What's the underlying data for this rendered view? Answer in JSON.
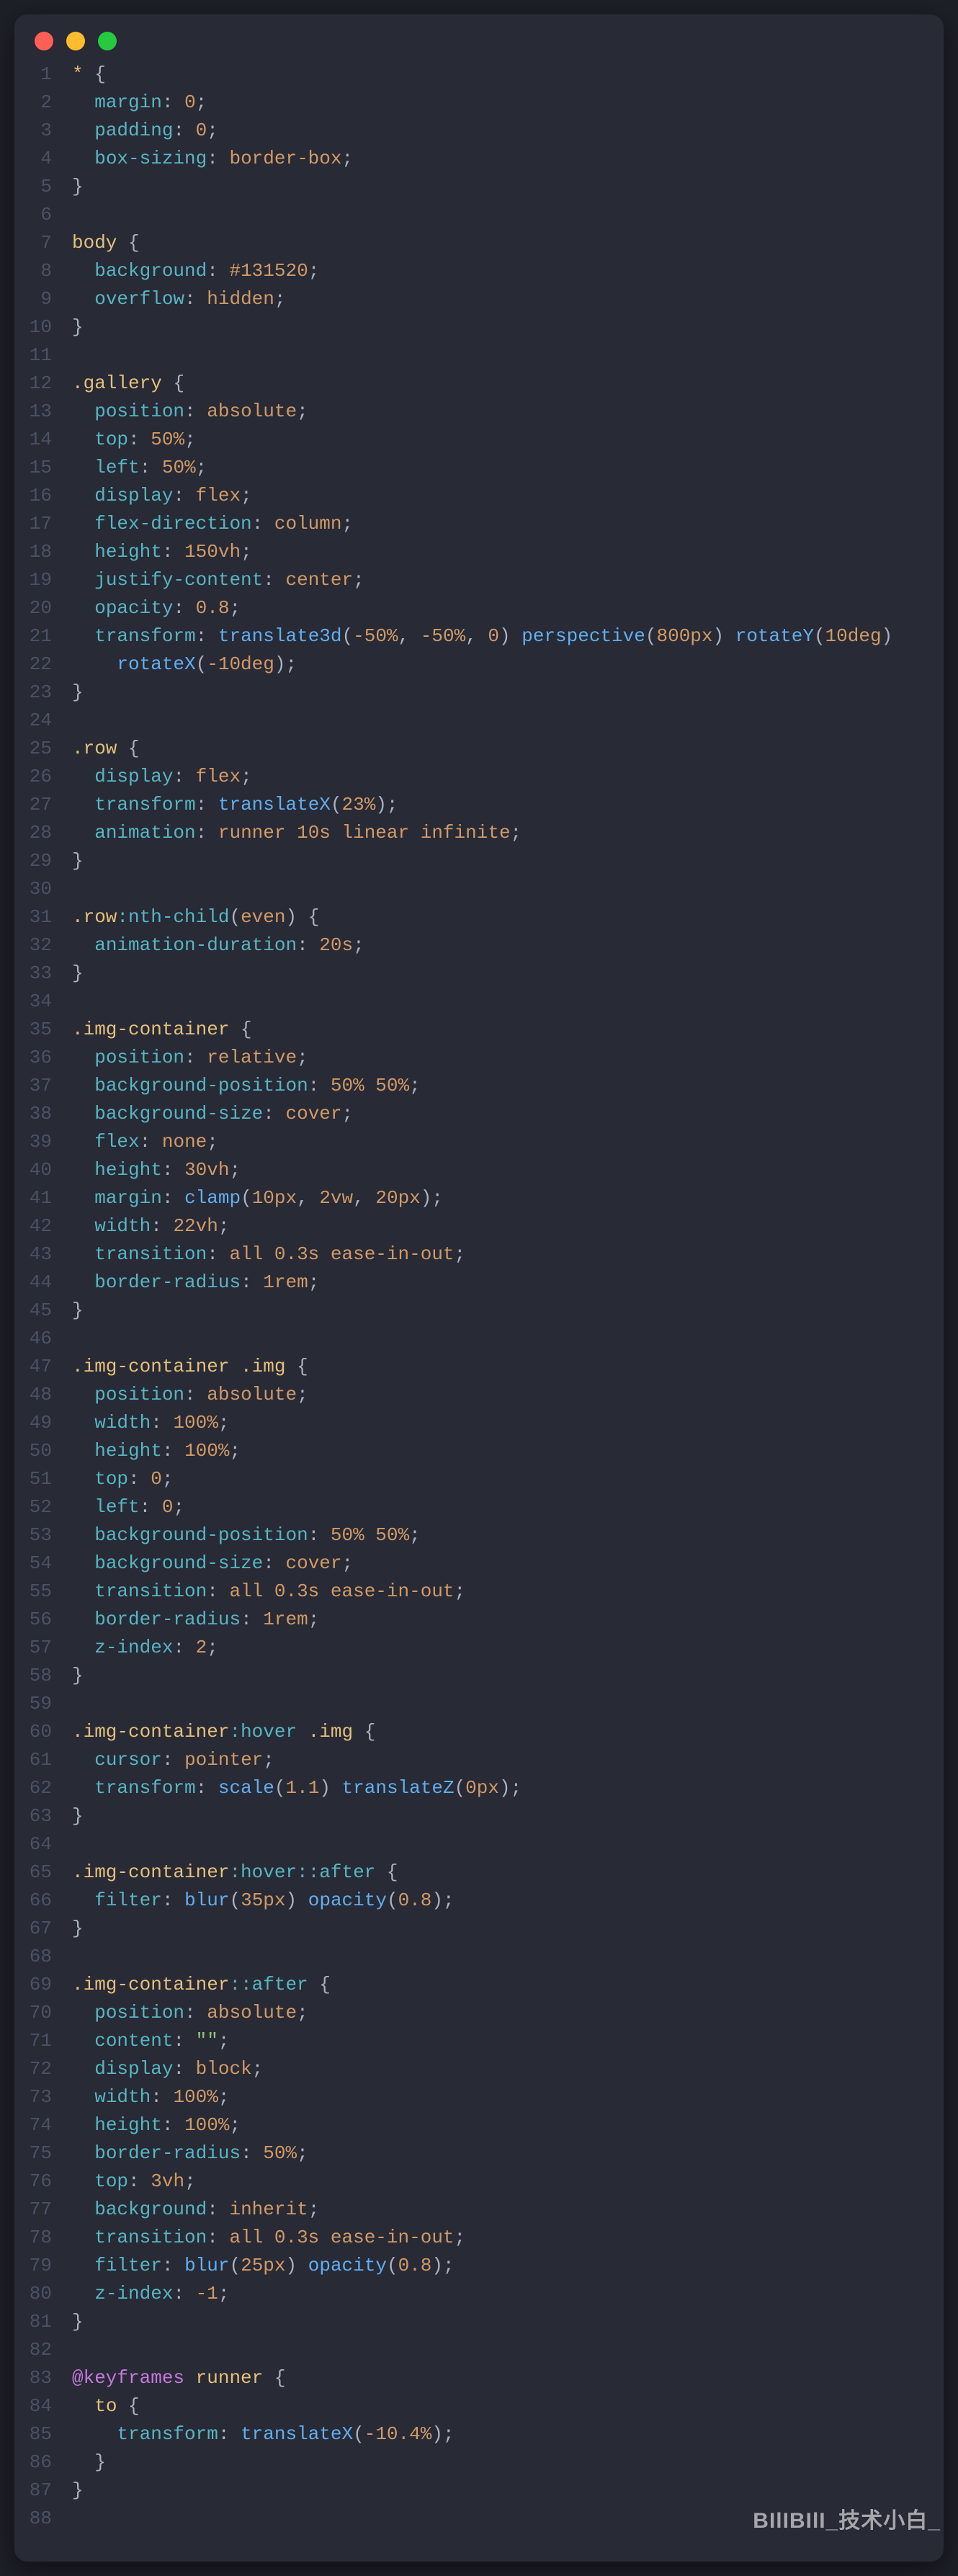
{
  "watermark": "BIlIBIlI_技术小白_",
  "traffic": {
    "red": "close",
    "yellow": "minimize",
    "green": "zoom"
  },
  "code": [
    [
      [
        "sel",
        "* "
      ],
      [
        "punc",
        "{"
      ]
    ],
    [
      [
        "punc",
        "  "
      ],
      [
        "prop",
        "margin"
      ],
      [
        "punc",
        ": "
      ],
      [
        "val",
        "0"
      ],
      [
        "punc",
        ";"
      ]
    ],
    [
      [
        "punc",
        "  "
      ],
      [
        "prop",
        "padding"
      ],
      [
        "punc",
        ": "
      ],
      [
        "val",
        "0"
      ],
      [
        "punc",
        ";"
      ]
    ],
    [
      [
        "punc",
        "  "
      ],
      [
        "prop",
        "box-sizing"
      ],
      [
        "punc",
        ": "
      ],
      [
        "val",
        "border-box"
      ],
      [
        "punc",
        ";"
      ]
    ],
    [
      [
        "punc",
        "}"
      ]
    ],
    [],
    [
      [
        "sel",
        "body "
      ],
      [
        "punc",
        "{"
      ]
    ],
    [
      [
        "punc",
        "  "
      ],
      [
        "prop",
        "background"
      ],
      [
        "punc",
        ": "
      ],
      [
        "val",
        "#131520"
      ],
      [
        "punc",
        ";"
      ]
    ],
    [
      [
        "punc",
        "  "
      ],
      [
        "prop",
        "overflow"
      ],
      [
        "punc",
        ": "
      ],
      [
        "val",
        "hidden"
      ],
      [
        "punc",
        ";"
      ]
    ],
    [
      [
        "punc",
        "}"
      ]
    ],
    [],
    [
      [
        "class",
        ".gallery "
      ],
      [
        "punc",
        "{"
      ]
    ],
    [
      [
        "punc",
        "  "
      ],
      [
        "prop",
        "position"
      ],
      [
        "punc",
        ": "
      ],
      [
        "val",
        "absolute"
      ],
      [
        "punc",
        ";"
      ]
    ],
    [
      [
        "punc",
        "  "
      ],
      [
        "prop",
        "top"
      ],
      [
        "punc",
        ": "
      ],
      [
        "val",
        "50%"
      ],
      [
        "punc",
        ";"
      ]
    ],
    [
      [
        "punc",
        "  "
      ],
      [
        "prop",
        "left"
      ],
      [
        "punc",
        ": "
      ],
      [
        "val",
        "50%"
      ],
      [
        "punc",
        ";"
      ]
    ],
    [
      [
        "punc",
        "  "
      ],
      [
        "prop",
        "display"
      ],
      [
        "punc",
        ": "
      ],
      [
        "val",
        "flex"
      ],
      [
        "punc",
        ";"
      ]
    ],
    [
      [
        "punc",
        "  "
      ],
      [
        "prop",
        "flex-direction"
      ],
      [
        "punc",
        ": "
      ],
      [
        "val",
        "column"
      ],
      [
        "punc",
        ";"
      ]
    ],
    [
      [
        "punc",
        "  "
      ],
      [
        "prop",
        "height"
      ],
      [
        "punc",
        ": "
      ],
      [
        "val",
        "150vh"
      ],
      [
        "punc",
        ";"
      ]
    ],
    [
      [
        "punc",
        "  "
      ],
      [
        "prop",
        "justify-content"
      ],
      [
        "punc",
        ": "
      ],
      [
        "val",
        "center"
      ],
      [
        "punc",
        ";"
      ]
    ],
    [
      [
        "punc",
        "  "
      ],
      [
        "prop",
        "opacity"
      ],
      [
        "punc",
        ": "
      ],
      [
        "val",
        "0.8"
      ],
      [
        "punc",
        ";"
      ]
    ],
    [
      [
        "punc",
        "  "
      ],
      [
        "prop",
        "transform"
      ],
      [
        "punc",
        ": "
      ],
      [
        "func",
        "translate3d"
      ],
      [
        "punc",
        "("
      ],
      [
        "val",
        "-50%"
      ],
      [
        "punc",
        ", "
      ],
      [
        "val",
        "-50%"
      ],
      [
        "punc",
        ", "
      ],
      [
        "val",
        "0"
      ],
      [
        "punc",
        ") "
      ],
      [
        "func",
        "perspective"
      ],
      [
        "punc",
        "("
      ],
      [
        "val",
        "800px"
      ],
      [
        "punc",
        ") "
      ],
      [
        "func",
        "rotateY"
      ],
      [
        "punc",
        "("
      ],
      [
        "val",
        "10deg"
      ],
      [
        "punc",
        ")"
      ]
    ],
    [
      [
        "punc",
        "    "
      ],
      [
        "func",
        "rotateX"
      ],
      [
        "punc",
        "("
      ],
      [
        "val",
        "-10deg"
      ],
      [
        "punc",
        ");"
      ]
    ],
    [
      [
        "punc",
        "}"
      ]
    ],
    [],
    [
      [
        "class",
        ".row "
      ],
      [
        "punc",
        "{"
      ]
    ],
    [
      [
        "punc",
        "  "
      ],
      [
        "prop",
        "display"
      ],
      [
        "punc",
        ": "
      ],
      [
        "val",
        "flex"
      ],
      [
        "punc",
        ";"
      ]
    ],
    [
      [
        "punc",
        "  "
      ],
      [
        "prop",
        "transform"
      ],
      [
        "punc",
        ": "
      ],
      [
        "func",
        "translateX"
      ],
      [
        "punc",
        "("
      ],
      [
        "val",
        "23%"
      ],
      [
        "punc",
        ");"
      ]
    ],
    [
      [
        "punc",
        "  "
      ],
      [
        "prop",
        "animation"
      ],
      [
        "punc",
        ": "
      ],
      [
        "val",
        "runner 10s linear infinite"
      ],
      [
        "punc",
        ";"
      ]
    ],
    [
      [
        "punc",
        "}"
      ]
    ],
    [],
    [
      [
        "class",
        ".row"
      ],
      [
        "pseudo",
        ":nth-child"
      ],
      [
        "punc",
        "("
      ],
      [
        "val",
        "even"
      ],
      [
        "punc",
        ") {"
      ]
    ],
    [
      [
        "punc",
        "  "
      ],
      [
        "prop",
        "animation-duration"
      ],
      [
        "punc",
        ": "
      ],
      [
        "val",
        "20s"
      ],
      [
        "punc",
        ";"
      ]
    ],
    [
      [
        "punc",
        "}"
      ]
    ],
    [],
    [
      [
        "class",
        ".img-container "
      ],
      [
        "punc",
        "{"
      ]
    ],
    [
      [
        "punc",
        "  "
      ],
      [
        "prop",
        "position"
      ],
      [
        "punc",
        ": "
      ],
      [
        "val",
        "relative"
      ],
      [
        "punc",
        ";"
      ]
    ],
    [
      [
        "punc",
        "  "
      ],
      [
        "prop",
        "background-position"
      ],
      [
        "punc",
        ": "
      ],
      [
        "val",
        "50% 50%"
      ],
      [
        "punc",
        ";"
      ]
    ],
    [
      [
        "punc",
        "  "
      ],
      [
        "prop",
        "background-size"
      ],
      [
        "punc",
        ": "
      ],
      [
        "val",
        "cover"
      ],
      [
        "punc",
        ";"
      ]
    ],
    [
      [
        "punc",
        "  "
      ],
      [
        "prop",
        "flex"
      ],
      [
        "punc",
        ": "
      ],
      [
        "val",
        "none"
      ],
      [
        "punc",
        ";"
      ]
    ],
    [
      [
        "punc",
        "  "
      ],
      [
        "prop",
        "height"
      ],
      [
        "punc",
        ": "
      ],
      [
        "val",
        "30vh"
      ],
      [
        "punc",
        ";"
      ]
    ],
    [
      [
        "punc",
        "  "
      ],
      [
        "prop",
        "margin"
      ],
      [
        "punc",
        ": "
      ],
      [
        "func",
        "clamp"
      ],
      [
        "punc",
        "("
      ],
      [
        "val",
        "10px"
      ],
      [
        "punc",
        ", "
      ],
      [
        "val",
        "2vw"
      ],
      [
        "punc",
        ", "
      ],
      [
        "val",
        "20px"
      ],
      [
        "punc",
        ");"
      ]
    ],
    [
      [
        "punc",
        "  "
      ],
      [
        "prop",
        "width"
      ],
      [
        "punc",
        ": "
      ],
      [
        "val",
        "22vh"
      ],
      [
        "punc",
        ";"
      ]
    ],
    [
      [
        "punc",
        "  "
      ],
      [
        "prop",
        "transition"
      ],
      [
        "punc",
        ": "
      ],
      [
        "val",
        "all 0.3s ease-in-out"
      ],
      [
        "punc",
        ";"
      ]
    ],
    [
      [
        "punc",
        "  "
      ],
      [
        "prop",
        "border-radius"
      ],
      [
        "punc",
        ": "
      ],
      [
        "val",
        "1rem"
      ],
      [
        "punc",
        ";"
      ]
    ],
    [
      [
        "punc",
        "}"
      ]
    ],
    [],
    [
      [
        "class",
        ".img-container .img "
      ],
      [
        "punc",
        "{"
      ]
    ],
    [
      [
        "punc",
        "  "
      ],
      [
        "prop",
        "position"
      ],
      [
        "punc",
        ": "
      ],
      [
        "val",
        "absolute"
      ],
      [
        "punc",
        ";"
      ]
    ],
    [
      [
        "punc",
        "  "
      ],
      [
        "prop",
        "width"
      ],
      [
        "punc",
        ": "
      ],
      [
        "val",
        "100%"
      ],
      [
        "punc",
        ";"
      ]
    ],
    [
      [
        "punc",
        "  "
      ],
      [
        "prop",
        "height"
      ],
      [
        "punc",
        ": "
      ],
      [
        "val",
        "100%"
      ],
      [
        "punc",
        ";"
      ]
    ],
    [
      [
        "punc",
        "  "
      ],
      [
        "prop",
        "top"
      ],
      [
        "punc",
        ": "
      ],
      [
        "val",
        "0"
      ],
      [
        "punc",
        ";"
      ]
    ],
    [
      [
        "punc",
        "  "
      ],
      [
        "prop",
        "left"
      ],
      [
        "punc",
        ": "
      ],
      [
        "val",
        "0"
      ],
      [
        "punc",
        ";"
      ]
    ],
    [
      [
        "punc",
        "  "
      ],
      [
        "prop",
        "background-position"
      ],
      [
        "punc",
        ": "
      ],
      [
        "val",
        "50% 50%"
      ],
      [
        "punc",
        ";"
      ]
    ],
    [
      [
        "punc",
        "  "
      ],
      [
        "prop",
        "background-size"
      ],
      [
        "punc",
        ": "
      ],
      [
        "val",
        "cover"
      ],
      [
        "punc",
        ";"
      ]
    ],
    [
      [
        "punc",
        "  "
      ],
      [
        "prop",
        "transition"
      ],
      [
        "punc",
        ": "
      ],
      [
        "val",
        "all 0.3s ease-in-out"
      ],
      [
        "punc",
        ";"
      ]
    ],
    [
      [
        "punc",
        "  "
      ],
      [
        "prop",
        "border-radius"
      ],
      [
        "punc",
        ": "
      ],
      [
        "val",
        "1rem"
      ],
      [
        "punc",
        ";"
      ]
    ],
    [
      [
        "punc",
        "  "
      ],
      [
        "prop",
        "z-index"
      ],
      [
        "punc",
        ": "
      ],
      [
        "val",
        "2"
      ],
      [
        "punc",
        ";"
      ]
    ],
    [
      [
        "punc",
        "}"
      ]
    ],
    [],
    [
      [
        "class",
        ".img-container"
      ],
      [
        "pseudo",
        ":hover"
      ],
      [
        "class",
        " .img "
      ],
      [
        "punc",
        "{"
      ]
    ],
    [
      [
        "punc",
        "  "
      ],
      [
        "prop",
        "cursor"
      ],
      [
        "punc",
        ": "
      ],
      [
        "val",
        "pointer"
      ],
      [
        "punc",
        ";"
      ]
    ],
    [
      [
        "punc",
        "  "
      ],
      [
        "prop",
        "transform"
      ],
      [
        "punc",
        ": "
      ],
      [
        "func",
        "scale"
      ],
      [
        "punc",
        "("
      ],
      [
        "val",
        "1.1"
      ],
      [
        "punc",
        ") "
      ],
      [
        "func",
        "translateZ"
      ],
      [
        "punc",
        "("
      ],
      [
        "val",
        "0px"
      ],
      [
        "punc",
        ");"
      ]
    ],
    [
      [
        "punc",
        "}"
      ]
    ],
    [],
    [
      [
        "class",
        ".img-container"
      ],
      [
        "pseudo",
        ":hover::after "
      ],
      [
        "punc",
        "{"
      ]
    ],
    [
      [
        "punc",
        "  "
      ],
      [
        "prop",
        "filter"
      ],
      [
        "punc",
        ": "
      ],
      [
        "func",
        "blur"
      ],
      [
        "punc",
        "("
      ],
      [
        "val",
        "35px"
      ],
      [
        "punc",
        ") "
      ],
      [
        "func",
        "opacity"
      ],
      [
        "punc",
        "("
      ],
      [
        "val",
        "0.8"
      ],
      [
        "punc",
        ");"
      ]
    ],
    [
      [
        "punc",
        "}"
      ]
    ],
    [],
    [
      [
        "class",
        ".img-container"
      ],
      [
        "pseudo",
        "::after "
      ],
      [
        "punc",
        "{"
      ]
    ],
    [
      [
        "punc",
        "  "
      ],
      [
        "prop",
        "position"
      ],
      [
        "punc",
        ": "
      ],
      [
        "val",
        "absolute"
      ],
      [
        "punc",
        ";"
      ]
    ],
    [
      [
        "punc",
        "  "
      ],
      [
        "prop",
        "content"
      ],
      [
        "punc",
        ": "
      ],
      [
        "str",
        "\"\""
      ],
      [
        "punc",
        ";"
      ]
    ],
    [
      [
        "punc",
        "  "
      ],
      [
        "prop",
        "display"
      ],
      [
        "punc",
        ": "
      ],
      [
        "val",
        "block"
      ],
      [
        "punc",
        ";"
      ]
    ],
    [
      [
        "punc",
        "  "
      ],
      [
        "prop",
        "width"
      ],
      [
        "punc",
        ": "
      ],
      [
        "val",
        "100%"
      ],
      [
        "punc",
        ";"
      ]
    ],
    [
      [
        "punc",
        "  "
      ],
      [
        "prop",
        "height"
      ],
      [
        "punc",
        ": "
      ],
      [
        "val",
        "100%"
      ],
      [
        "punc",
        ";"
      ]
    ],
    [
      [
        "punc",
        "  "
      ],
      [
        "prop",
        "border-radius"
      ],
      [
        "punc",
        ": "
      ],
      [
        "val",
        "50%"
      ],
      [
        "punc",
        ";"
      ]
    ],
    [
      [
        "punc",
        "  "
      ],
      [
        "prop",
        "top"
      ],
      [
        "punc",
        ": "
      ],
      [
        "val",
        "3vh"
      ],
      [
        "punc",
        ";"
      ]
    ],
    [
      [
        "punc",
        "  "
      ],
      [
        "prop",
        "background"
      ],
      [
        "punc",
        ": "
      ],
      [
        "val",
        "inherit"
      ],
      [
        "punc",
        ";"
      ]
    ],
    [
      [
        "punc",
        "  "
      ],
      [
        "prop",
        "transition"
      ],
      [
        "punc",
        ": "
      ],
      [
        "val",
        "all 0.3s ease-in-out"
      ],
      [
        "punc",
        ";"
      ]
    ],
    [
      [
        "punc",
        "  "
      ],
      [
        "prop",
        "filter"
      ],
      [
        "punc",
        ": "
      ],
      [
        "func",
        "blur"
      ],
      [
        "punc",
        "("
      ],
      [
        "val",
        "25px"
      ],
      [
        "punc",
        ") "
      ],
      [
        "func",
        "opacity"
      ],
      [
        "punc",
        "("
      ],
      [
        "val",
        "0.8"
      ],
      [
        "punc",
        ");"
      ]
    ],
    [
      [
        "punc",
        "  "
      ],
      [
        "prop",
        "z-index"
      ],
      [
        "punc",
        ": "
      ],
      [
        "val",
        "-1"
      ],
      [
        "punc",
        ";"
      ]
    ],
    [
      [
        "punc",
        "}"
      ]
    ],
    [],
    [
      [
        "kw",
        "@keyframes"
      ],
      [
        "sel",
        " runner "
      ],
      [
        "punc",
        "{"
      ]
    ],
    [
      [
        "punc",
        "  "
      ],
      [
        "sel",
        "to "
      ],
      [
        "punc",
        "{"
      ]
    ],
    [
      [
        "punc",
        "    "
      ],
      [
        "prop",
        "transform"
      ],
      [
        "punc",
        ": "
      ],
      [
        "func",
        "translateX"
      ],
      [
        "punc",
        "("
      ],
      [
        "val",
        "-10.4%"
      ],
      [
        "punc",
        ");"
      ]
    ],
    [
      [
        "punc",
        "  }"
      ]
    ],
    [
      [
        "punc",
        "}"
      ]
    ],
    []
  ]
}
